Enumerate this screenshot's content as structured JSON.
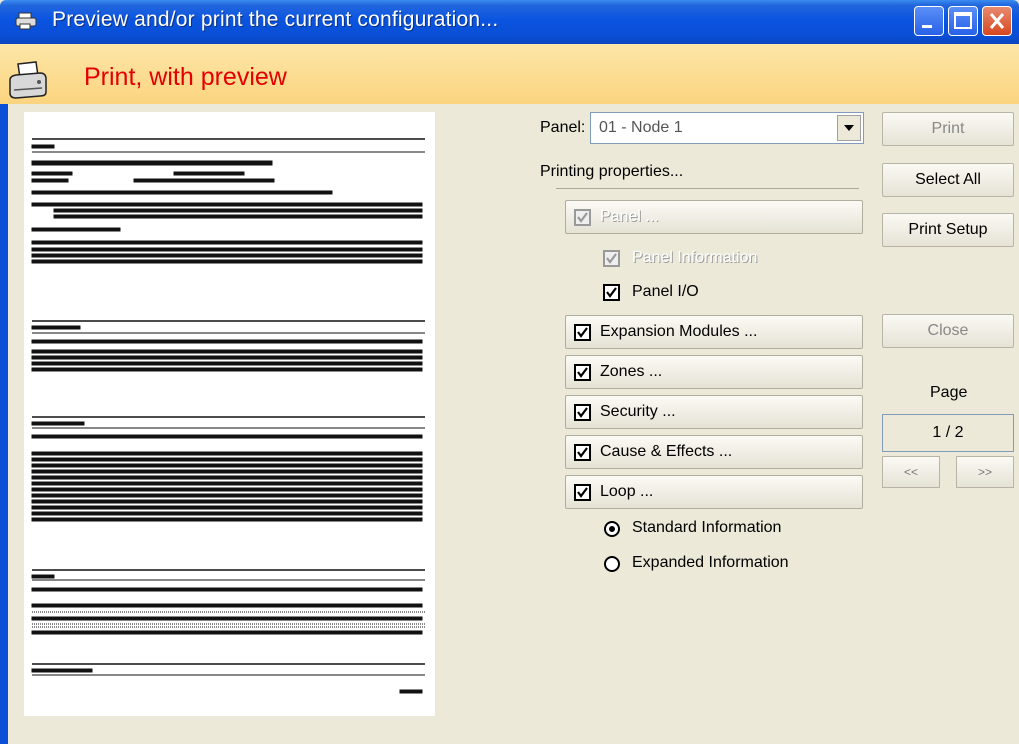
{
  "window": {
    "title": "Preview and/or print the current configuration..."
  },
  "header": {
    "title": "Print, with preview"
  },
  "panel": {
    "label": "Panel:",
    "selected": "01 - Node 1"
  },
  "printing_properties_label": "Printing properties...",
  "checks": {
    "panel": {
      "label": "Panel ...",
      "checked": true,
      "enabled": false
    },
    "panel_information": {
      "label": "Panel Information",
      "checked": true,
      "enabled": false
    },
    "panel_io": {
      "label": "Panel I/O",
      "checked": true,
      "enabled": true
    },
    "expansion_modules": {
      "label": "Expansion Modules ...",
      "checked": true,
      "enabled": true
    },
    "zones": {
      "label": "Zones ...",
      "checked": true,
      "enabled": true
    },
    "security": {
      "label": "Security ...",
      "checked": true,
      "enabled": true
    },
    "cause_effects": {
      "label": "Cause & Effects ...",
      "checked": true,
      "enabled": true
    },
    "loop": {
      "label": "Loop ...",
      "checked": true,
      "enabled": true
    }
  },
  "radios": {
    "standard": {
      "label": "Standard Information",
      "selected": true
    },
    "expanded": {
      "label": "Expanded Information",
      "selected": false
    }
  },
  "buttons": {
    "print": "Print",
    "select_all": "Select All",
    "print_setup": "Print Setup",
    "close": "Close",
    "prev": "<<",
    "next": ">>"
  },
  "page": {
    "label": "Page",
    "value": "1 / 2"
  },
  "colors": {
    "title_bar": "#0a4fd6",
    "header_band": "#fbd47f",
    "header_text": "#e40000"
  }
}
